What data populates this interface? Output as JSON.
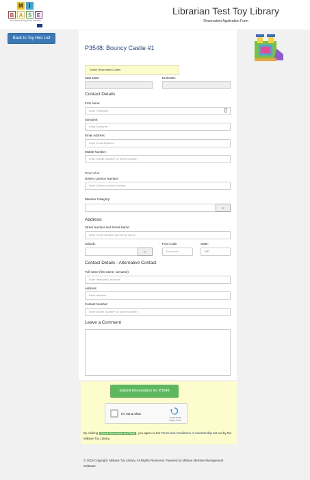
{
  "header": {
    "logo_letters_top": [
      "M",
      "I"
    ],
    "logo_letters_bottom": [
      "B",
      "A",
      "S",
      "E"
    ],
    "logo_tagline": "Toy Library Management Software",
    "title": "Librarian Test Toy Library",
    "subtitle": "Reservation Application Form",
    "colors": {
      "m": "#f0c419",
      "i": "#3aa8d8",
      "b": "#d8332b",
      "a": "#f0c419",
      "s": "#4da84d",
      "e": "#8b2a8c"
    }
  },
  "nav": {
    "back_label": "Back to Toy Hire List"
  },
  "toy": {
    "title": "P3548: Bouncy Castle #1"
  },
  "dates": {
    "select_label": "Select Reservation Dates",
    "start_label": "Start Date:",
    "end_label": "End Date:"
  },
  "contact": {
    "heading": "Contact Details",
    "first_name_label": "First name:",
    "first_name_placeholder": "Enter Firstname",
    "surname_label": "Surname:",
    "surname_placeholder": "Enter Surname",
    "email_label": "Email Address:",
    "email_placeholder": "Enter Email Address",
    "mobile_label": "Mobile Number:",
    "mobile_placeholder": "Enter Mobile Number (or home number)",
    "proof_label": "Proof of id:",
    "licence_label": "Drivers Licence Number:",
    "licence_placeholder": "Enter Drivers Licence Number",
    "member_category_label": "Member Category:"
  },
  "address": {
    "heading": "Address:",
    "street_label": "Street Number and Street Name:",
    "street_placeholder": "Enter Street Number and Street Name",
    "suburb_label": "Suburb:",
    "postcode_label": "Post Code:",
    "postcode_placeholder": "Post code",
    "state_label": "State:",
    "state_value": "VIC"
  },
  "alt_contact": {
    "heading": "Contact Details - Alternative Contact",
    "fullname_label": "Full name (first name, surname):",
    "fullname_placeholder": "Enter firstname Lastname",
    "address_label": "Address:",
    "address_placeholder": "Enter Address",
    "number_label": "Contact Number:",
    "number_placeholder": "Enter Mobile Number (or home number)"
  },
  "comment": {
    "heading": "Leave a Comment"
  },
  "submit": {
    "label": "Submit Reservation for P3548"
  },
  "captcha": {
    "label": "I'm not a robot",
    "brand": "reCAPTCHA",
    "links": "Privacy - Terms"
  },
  "terms": {
    "prefix": "By clicking",
    "pill": "Submit Reservation for P3548",
    "middle": ", you agree to the",
    "link": "Terms and Conditions of membership",
    "suffix": "set out by the MiBase Toy Library."
  },
  "footer": {
    "text": "© 2019 Copyright: MiBase Toy Library. All Rights Reserved. Powered by Mibase Member Management Software."
  }
}
